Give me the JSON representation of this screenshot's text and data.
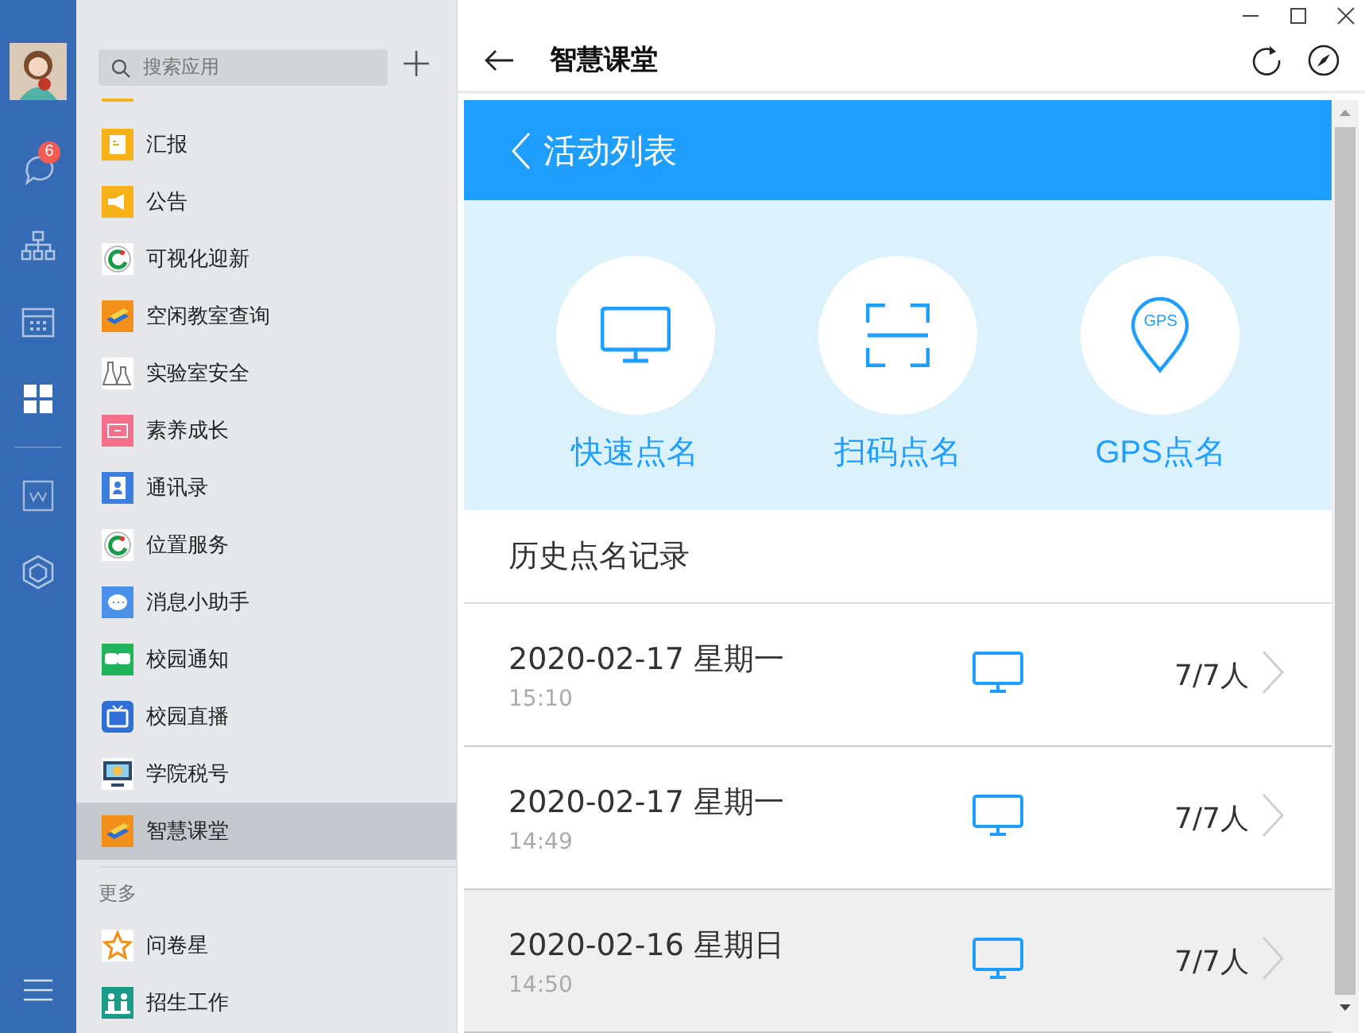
{
  "rail": {
    "items": [
      {
        "selected": false,
        "badge": "6"
      },
      {
        "selected": false
      },
      {
        "selected": false
      },
      {
        "selected": true
      },
      {
        "selected": false
      },
      {
        "selected": false
      }
    ]
  },
  "apps": {
    "search": {
      "placeholder": "搜索应用"
    },
    "items": [
      {
        "label": "汇报",
        "selected": false
      },
      {
        "label": "公告",
        "selected": false
      },
      {
        "label": "可视化迎新",
        "selected": false
      },
      {
        "label": "空闲教室查询",
        "selected": false
      },
      {
        "label": "实验室安全",
        "selected": false
      },
      {
        "label": "素养成长",
        "selected": false
      },
      {
        "label": "通讯录",
        "selected": false
      },
      {
        "label": "位置服务",
        "selected": false
      },
      {
        "label": "消息小助手",
        "selected": false
      },
      {
        "label": "校园通知",
        "selected": false
      },
      {
        "label": "校园直播",
        "selected": false
      },
      {
        "label": "学院税号",
        "selected": false
      },
      {
        "label": "智慧课堂",
        "selected": true
      }
    ],
    "more_heading": "更多",
    "more_items": [
      {
        "label": "问卷星",
        "selected": false
      },
      {
        "label": "招生工作",
        "selected": false
      }
    ]
  },
  "window": {
    "title": "智慧课堂"
  },
  "page": {
    "title": "活动列表",
    "actions": [
      {
        "label": "快速点名"
      },
      {
        "label": "扫码点名"
      },
      {
        "label": "GPS点名",
        "icon_text": "GPS"
      }
    ],
    "history_heading": "历史点名记录",
    "rows": [
      {
        "date": "2020-02-17 星期一",
        "time": "15:10",
        "count": "7/7人",
        "selected": false
      },
      {
        "date": "2020-02-17 星期一",
        "time": "14:49",
        "count": "7/7人",
        "selected": false
      },
      {
        "date": "2020-02-16 星期日",
        "time": "14:50",
        "count": "7/7人",
        "selected": true
      }
    ]
  }
}
